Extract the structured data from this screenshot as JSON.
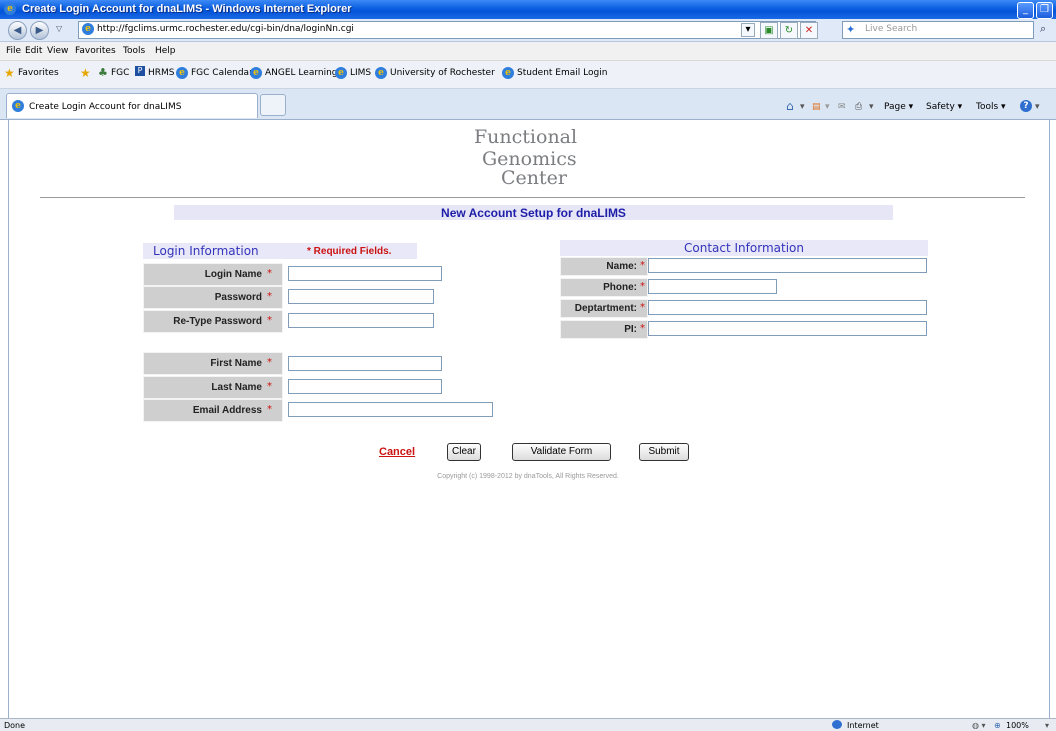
{
  "window": {
    "title": "Create Login Account for dnaLIMS - Windows Internet Explorer",
    "minimize": "_",
    "maximize": "❐"
  },
  "address_bar": {
    "url": "http://fgclims.urmc.rochester.edu/cgi-bin/dna/loginNn.cgi",
    "search_placeholder": "Live Search"
  },
  "menu": [
    "File",
    "Edit",
    "View",
    "Favorites",
    "Tools",
    "Help"
  ],
  "favorites_bar": {
    "label": "Favorites",
    "items": [
      "FGC",
      "HRMS",
      "FGC Calendar",
      "ANGEL Learning",
      "LIMS",
      "University of Rochester",
      "Student Email Login"
    ]
  },
  "tab": {
    "label": "Create Login Account for dnaLIMS"
  },
  "command_bar": [
    "Page ▾",
    "Safety ▾",
    "Tools ▾"
  ],
  "page": {
    "logo_lines": [
      "Functional",
      "Genomics",
      "Center"
    ],
    "heading": "New Account Setup for dnaLIMS",
    "login_section": {
      "title": "Login Information",
      "required_note": "* Required Fields.",
      "fields": [
        {
          "label": "Login Name",
          "value": ""
        },
        {
          "label": "Password",
          "value": ""
        },
        {
          "label": "Re-Type Password",
          "value": ""
        },
        {
          "label": "First Name",
          "value": ""
        },
        {
          "label": "Last Name",
          "value": ""
        },
        {
          "label": "Email Address",
          "value": ""
        }
      ]
    },
    "contact_section": {
      "title": "Contact Information",
      "fields": [
        {
          "label": "Name:",
          "value": ""
        },
        {
          "label": "Phone:",
          "value": ""
        },
        {
          "label": "Deptartment:",
          "value": ""
        },
        {
          "label": "PI:",
          "value": ""
        }
      ]
    },
    "required_mark": "*",
    "buttons": {
      "cancel": "Cancel",
      "clear": "Clear",
      "validate": "Validate Form",
      "submit": "Submit"
    },
    "copyright": "Copyright (c) 1998-2012 by dnaTools, All Rights Reserved."
  },
  "status_bar": {
    "left": "Done",
    "zone": "Internet",
    "zoom": "100%"
  }
}
